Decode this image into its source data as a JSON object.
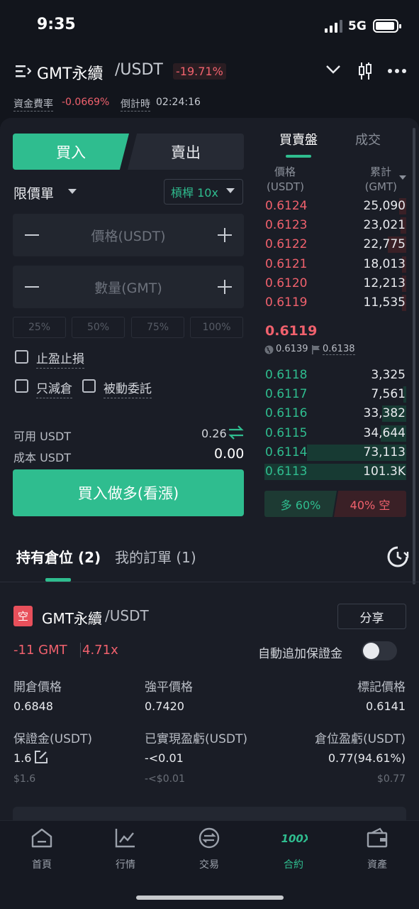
{
  "status_bar": {
    "time": "9:35",
    "network": "5G"
  },
  "header": {
    "pair": "GMT永續",
    "quote": "/USDT",
    "change": "-19.71%",
    "funding_label": "資金費率",
    "funding_value": "-0.0669%",
    "countdown_label": "倒計時",
    "countdown_value": "02:24:16"
  },
  "trade": {
    "buy_tab": "買入",
    "sell_tab": "賣出",
    "order_type": "限價單",
    "leverage": "槓桿 10x",
    "price_placeholder": "價格(USDT)",
    "qty_placeholder": "數量(GMT)",
    "percents": [
      "25%",
      "50%",
      "75%",
      "100%"
    ],
    "tp_sl": "止盈止損",
    "reduce_only": "只減倉",
    "post_only": "被動委託",
    "avail_label": "可用 USDT",
    "avail_value": "0.26",
    "cost_label": "成本 USDT",
    "cost_value": "0.00",
    "submit": "買入做多(看漲)"
  },
  "orderbook": {
    "tab_book": "買賣盤",
    "tab_trades": "成交",
    "header_price_line1": "價格",
    "header_price_line2": "(USDT)",
    "header_total_line1": "累計",
    "header_total_line2": "(GMT)",
    "asks": [
      {
        "price": "0.6124",
        "total": "25,090",
        "depth": 0.05
      },
      {
        "price": "0.6123",
        "total": "23,021",
        "depth": 0.04
      },
      {
        "price": "0.6122",
        "total": "22,775",
        "depth": 0.13
      },
      {
        "price": "0.6121",
        "total": "18,013",
        "depth": 0.03
      },
      {
        "price": "0.6120",
        "total": "12,213",
        "depth": 0.03
      },
      {
        "price": "0.6119",
        "total": "11,535",
        "depth": 0.03
      }
    ],
    "last_price": "0.6119",
    "index_price": "0.6139",
    "mark_price": "0.6138",
    "bids": [
      {
        "price": "0.6118",
        "total": "3,325",
        "depth": 0.0
      },
      {
        "price": "0.6117",
        "total": "7,561",
        "depth": 0.02
      },
      {
        "price": "0.6116",
        "total": "33,382",
        "depth": 0.17
      },
      {
        "price": "0.6115",
        "total": "34,644",
        "depth": 0.18
      },
      {
        "price": "0.6114",
        "total": "73,113",
        "depth": 0.7
      },
      {
        "price": "0.6113",
        "total": "101.3K",
        "depth": 1.0
      }
    ],
    "long_ratio": "多 60%",
    "short_ratio": "40% 空"
  },
  "positions": {
    "tab_positions": "持有倉位 (2)",
    "tab_orders": "我的訂單 (1)",
    "side_badge": "空",
    "pair": "GMT永續",
    "quote": "/USDT",
    "share": "分享",
    "size": "-11 GMT",
    "leverage": "4.71x",
    "auto_margin_label": "自動追加保證金",
    "entry_label": "開倉價格",
    "entry_value": "0.6848",
    "liq_label": "強平價格",
    "liq_value": "0.7420",
    "mark_label": "標記價格",
    "mark_value": "0.6141",
    "margin_label": "保證金(USDT)",
    "margin_value": "1.6",
    "margin_usd": "$1.6",
    "realized_label": "已實現盈虧(USDT)",
    "realized_value": "-<0.01",
    "realized_usd": "-<$0.01",
    "pnl_label": "倉位盈虧(USDT)",
    "pnl_value": "0.77(94.61%)",
    "pnl_usd": "$0.77"
  },
  "bottom_nav": [
    {
      "label": "首頁",
      "icon": "home-icon"
    },
    {
      "label": "行情",
      "icon": "market-icon"
    },
    {
      "label": "交易",
      "icon": "trade-icon"
    },
    {
      "label": "合約",
      "icon": "futures-icon",
      "badge": "100X"
    },
    {
      "label": "資產",
      "icon": "wallet-icon"
    }
  ],
  "colors": {
    "accent": "#2fbd8f",
    "sell": "#f0616d",
    "background": "#12151c"
  }
}
